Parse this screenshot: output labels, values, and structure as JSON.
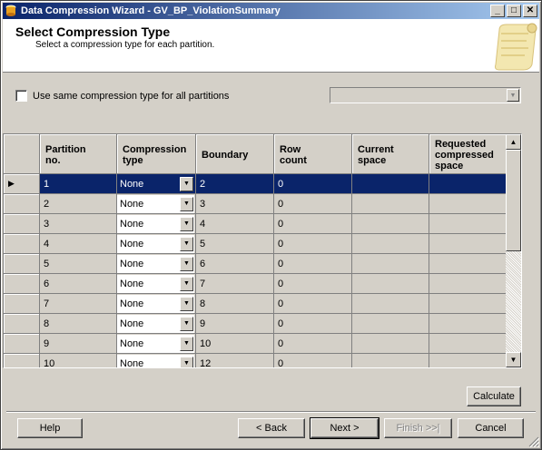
{
  "window": {
    "title": "Data Compression Wizard - GV_BP_ViolationSummary",
    "minimize_glyph": "_",
    "maximize_glyph": "□",
    "close_glyph": "✕"
  },
  "header": {
    "title": "Select Compression Type",
    "subtitle": "Select a compression type for each partition."
  },
  "same_type": {
    "label": "Use same compression type for all partitions",
    "checked": false,
    "combo_value": ""
  },
  "grid": {
    "columns": [
      "Partition\nno.",
      "Compression\ntype",
      "Boundary",
      "Row\ncount",
      "Current\nspace",
      "Requested\ncompressed\nspace"
    ],
    "selected_row_index": 0,
    "current_row_marker": "▶",
    "rows": [
      {
        "partition": "1",
        "type": "None",
        "boundary": "2",
        "row_count": "0",
        "current": "",
        "requested": ""
      },
      {
        "partition": "2",
        "type": "None",
        "boundary": "3",
        "row_count": "0",
        "current": "",
        "requested": ""
      },
      {
        "partition": "3",
        "type": "None",
        "boundary": "4",
        "row_count": "0",
        "current": "",
        "requested": ""
      },
      {
        "partition": "4",
        "type": "None",
        "boundary": "5",
        "row_count": "0",
        "current": "",
        "requested": ""
      },
      {
        "partition": "5",
        "type": "None",
        "boundary": "6",
        "row_count": "0",
        "current": "",
        "requested": ""
      },
      {
        "partition": "6",
        "type": "None",
        "boundary": "7",
        "row_count": "0",
        "current": "",
        "requested": ""
      },
      {
        "partition": "7",
        "type": "None",
        "boundary": "8",
        "row_count": "0",
        "current": "",
        "requested": ""
      },
      {
        "partition": "8",
        "type": "None",
        "boundary": "9",
        "row_count": "0",
        "current": "",
        "requested": ""
      },
      {
        "partition": "9",
        "type": "None",
        "boundary": "10",
        "row_count": "0",
        "current": "",
        "requested": ""
      },
      {
        "partition": "10",
        "type": "None",
        "boundary": "12",
        "row_count": "0",
        "current": "",
        "requested": ""
      }
    ]
  },
  "buttons": {
    "calculate": "Calculate",
    "help": "Help",
    "back": "< Back",
    "next": "Next >",
    "finish": "Finish >>|",
    "cancel": "Cancel"
  },
  "colors": {
    "selection": "#0a246a",
    "face": "#d4d0c8",
    "title_gradient_start": "#0a246a",
    "title_gradient_end": "#a6caf0"
  },
  "icons": {
    "app": "database-wizard-icon",
    "header_art": "scroll-paper-icon",
    "row_marker": "current-row-arrow-icon",
    "dropdown": "dropdown-arrow-icon"
  }
}
